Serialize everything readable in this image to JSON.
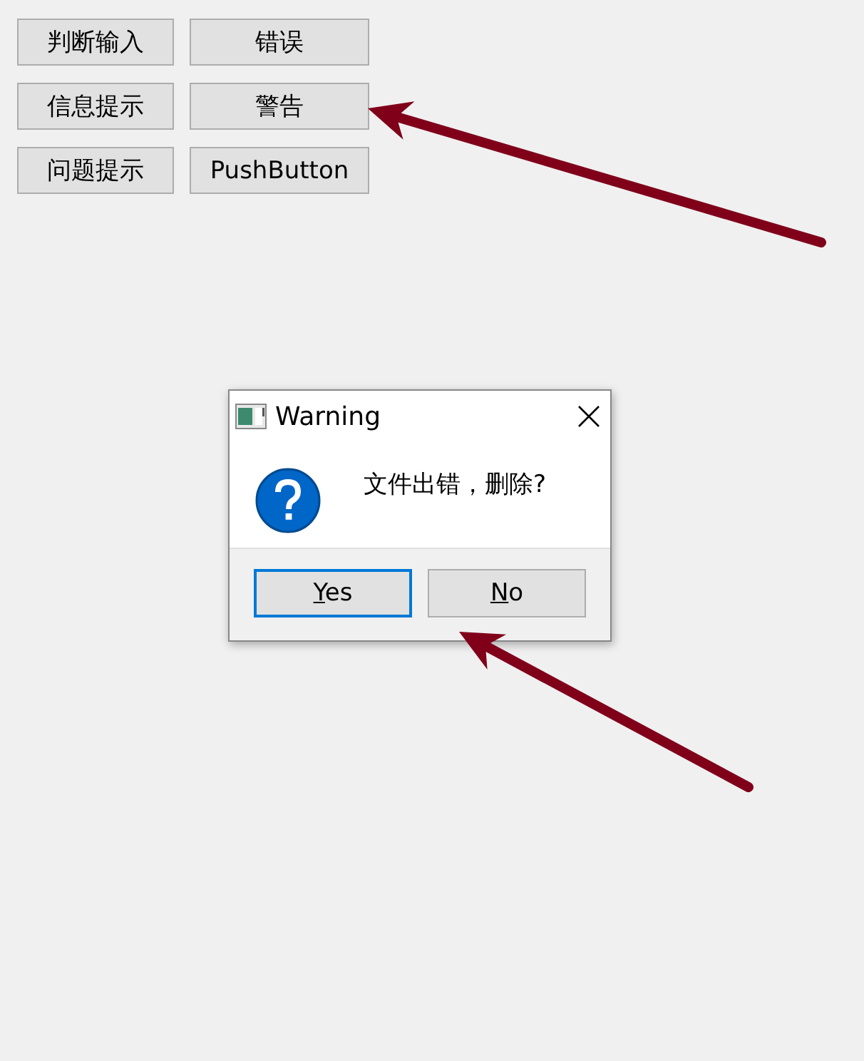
{
  "buttons": [
    {
      "label": "判断输入"
    },
    {
      "label": "错误"
    },
    {
      "label": "信息提示"
    },
    {
      "label": "警告"
    },
    {
      "label": "问题提示"
    },
    {
      "label": "PushButton"
    }
  ],
  "dialog": {
    "title": "Warning",
    "kind": "question",
    "message": "文件出错，删除?",
    "buttons": [
      {
        "label": "Yes",
        "focused": true,
        "underline_first": true
      },
      {
        "label": "No",
        "focused": false,
        "underline_first": true
      }
    ]
  }
}
